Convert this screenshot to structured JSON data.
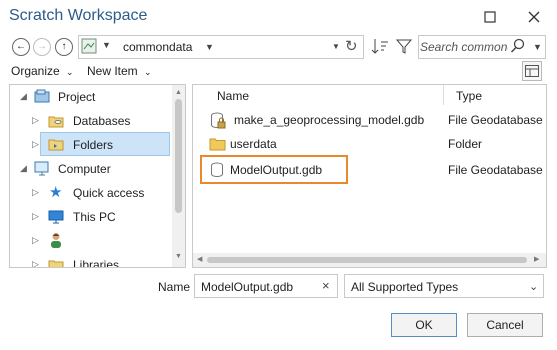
{
  "window": {
    "title": "Scratch Workspace",
    "accent": "#2b5c8a"
  },
  "toolbar": {
    "path": "commondata",
    "search_placeholder": "Search commondata"
  },
  "menubar": {
    "organize": "Organize",
    "new_item": "New Item"
  },
  "tree": {
    "items": [
      {
        "label": "Project",
        "icon": "project-icon"
      },
      {
        "label": "Databases",
        "icon": "database-folder-icon"
      },
      {
        "label": "Folders",
        "icon": "folder-icon",
        "selected": true
      },
      {
        "label": "Computer",
        "icon": "computer-icon"
      },
      {
        "label": "Quick access",
        "icon": "star-icon"
      },
      {
        "label": "This PC",
        "icon": "monitor-icon"
      },
      {
        "label": "",
        "icon": "user-icon"
      },
      {
        "label": "Libraries",
        "icon": "library-icon"
      }
    ]
  },
  "files": {
    "columns": [
      "Name",
      "Type"
    ],
    "rows": [
      {
        "name": "make_a_geoprocessing_model.gdb",
        "type": "File Geodatabase",
        "icon": "geodatabase-lock-icon"
      },
      {
        "name": "userdata",
        "type": "Folder",
        "icon": "folder-icon"
      },
      {
        "name": "ModelOutput.gdb",
        "type": "File Geodatabase",
        "icon": "geodatabase-icon",
        "highlighted": true
      }
    ],
    "highlight_color": "#e8892b"
  },
  "form": {
    "name_label": "Name",
    "name_value": "ModelOutput.gdb",
    "type_value": "All Supported Types"
  },
  "buttons": {
    "ok": "OK",
    "cancel": "Cancel"
  }
}
